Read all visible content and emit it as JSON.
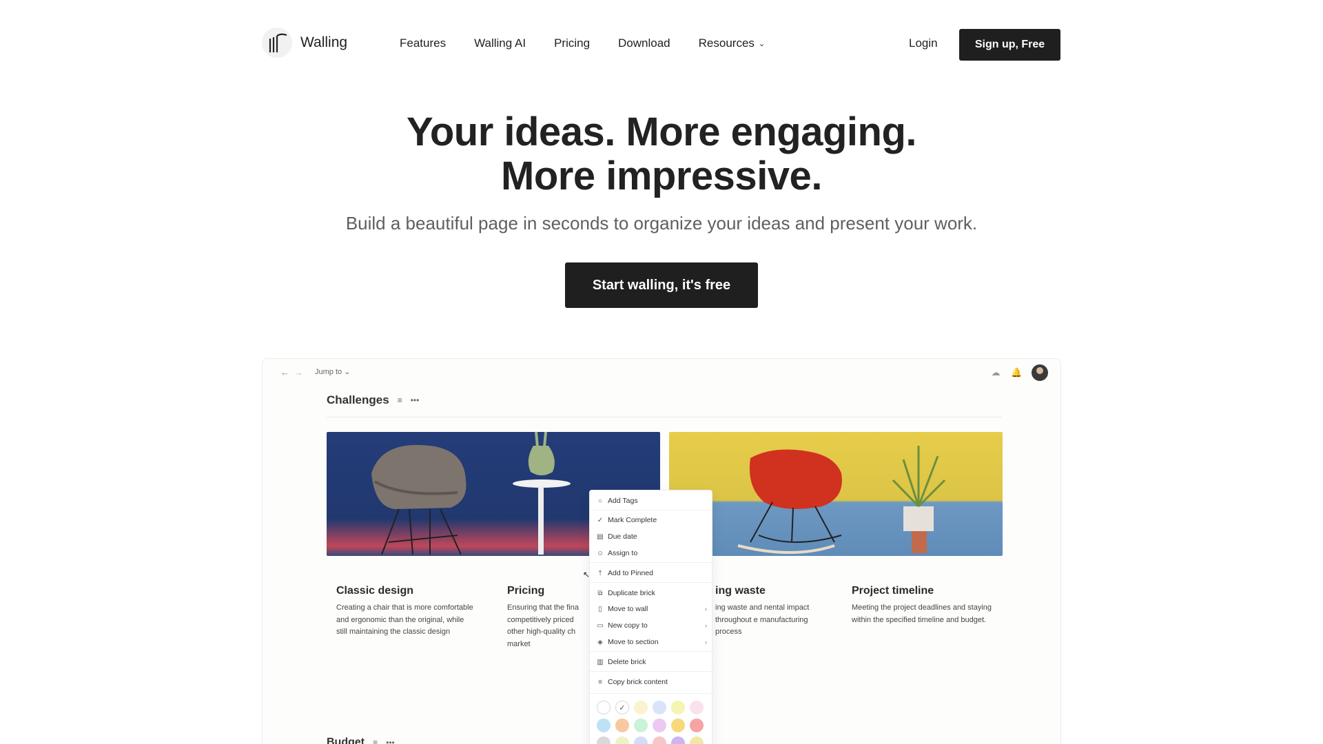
{
  "brand": {
    "name": "Walling"
  },
  "nav": {
    "links": [
      "Features",
      "Walling AI",
      "Pricing",
      "Download",
      "Resources"
    ],
    "login": "Login",
    "signup": "Sign up, Free"
  },
  "hero": {
    "title_line1": "Your ideas. More engaging.",
    "title_line2": "More impressive.",
    "subtitle": "Build a beautiful page in seconds to organize your ideas and present your work.",
    "cta": "Start walling, it's free"
  },
  "app": {
    "jump_to": "Jump to",
    "section_title": "Challenges",
    "section2_title": "Budget",
    "cards": [
      {
        "title": "Classic design",
        "desc": "Creating a chair that is more comfortable and ergonomic than the original, while still maintaining the classic design"
      },
      {
        "title": "Pricing",
        "desc": "Ensuring that the fina competitively priced other high-quality ch market"
      },
      {
        "title": "ing waste",
        "desc": "ing waste and nental impact throughout e manufacturing process"
      },
      {
        "title": "Project timeline",
        "desc": "Meeting the project deadlines and staying within the specified timeline and budget."
      }
    ],
    "menu": [
      {
        "label": "Add Tags",
        "icon": "tag-icon"
      },
      {
        "label": "Mark Complete",
        "icon": "check-icon"
      },
      {
        "label": "Due date",
        "icon": "calendar-icon"
      },
      {
        "label": "Assign to",
        "icon": "user-icon"
      },
      {
        "label": "Add to Pinned",
        "icon": "pin-icon"
      },
      {
        "label": "Duplicate brick",
        "icon": "copy-icon"
      },
      {
        "label": "Move to wall",
        "icon": "file-icon"
      },
      {
        "label": "New copy to",
        "icon": "file-plus-icon"
      },
      {
        "label": "Move to section",
        "icon": "layers-icon"
      },
      {
        "label": "Delete brick",
        "icon": "trash-icon"
      },
      {
        "label": "Copy brick content",
        "icon": "lines-icon"
      }
    ],
    "swatch_colors": [
      "#ffffff",
      "#ffffff",
      "#fbf3cf",
      "#d9e4fb",
      "#f3f5b0",
      "#fbe1ea",
      "#bfe1f6",
      "#f8c9a1",
      "#c9f2d6",
      "#ecc9f3",
      "#f7d97c",
      "#f6a3a3",
      "#d9d9d9",
      "#eef3c6",
      "#d6dcf7",
      "#f7c6c6",
      "#cfb4ee",
      "#f1e8a8"
    ]
  }
}
